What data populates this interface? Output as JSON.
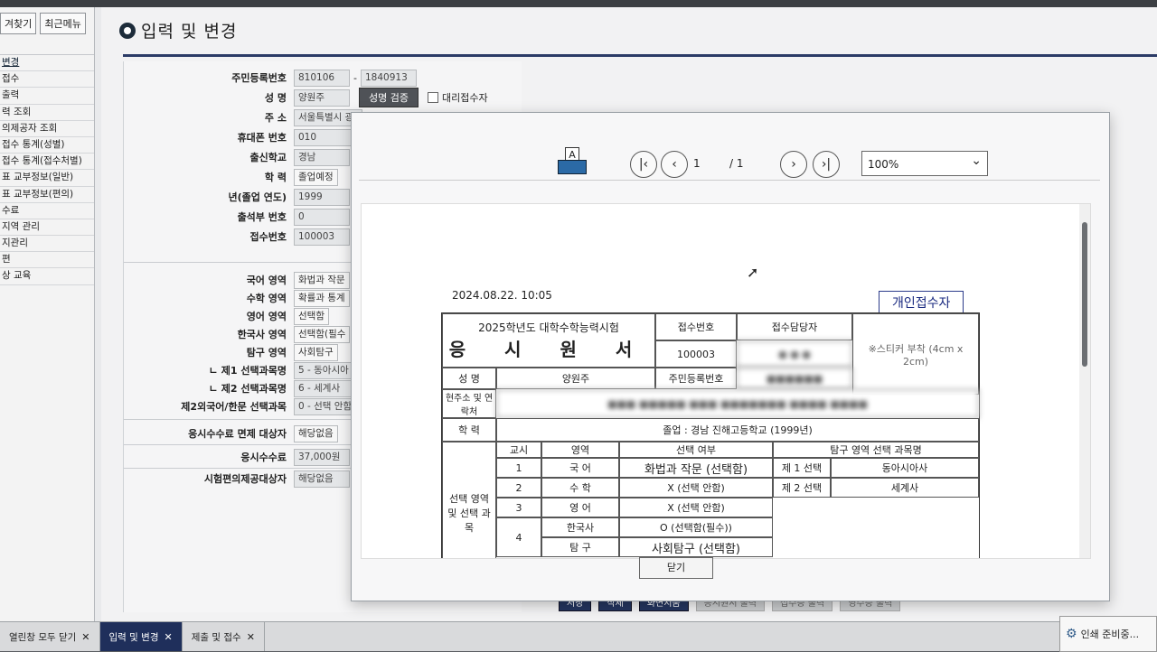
{
  "sidebar": {
    "tabs": [
      "겨찾기",
      "최근메뉴"
    ],
    "items": [
      "변경",
      "접수",
      "출력",
      "력 조회",
      "의제공자 조회",
      "접수 통계(성별)",
      "접수 통계(접수처별)",
      "표 교부정보(일반)",
      "표 교부정보(편의)",
      "수료",
      "지역 관리",
      "지관리",
      "편",
      "상 교육"
    ]
  },
  "main": {
    "page_title": "입력 및 변경",
    "form": {
      "jumin_label": "주민등록번호",
      "jumin_front": "810106",
      "jumin_sep": "-",
      "jumin_back": "1840913",
      "name_label": "성 명",
      "name_value": "양원주",
      "verify_label": "성명 검증",
      "proxy_label": "대리접수자",
      "addr_label": "주 소",
      "addr_value": "서울특별시 광",
      "phone_label": "휴대폰 번호",
      "phone_value": "010",
      "school_label": "출신학교",
      "school_value": "경남",
      "degree_label": "학 력",
      "degree_value": "졸업예정",
      "grad_label": "년(졸업 연도)",
      "grad_value": "1999",
      "attend_label": "출석부 번호",
      "attend_value": "0",
      "receipt_label": "접수번호",
      "receipt_value": "100003",
      "korean_label": "국어 영역",
      "korean_value": "화법과 작문",
      "math_label": "수학 영역",
      "math_value": "확률과 통계",
      "english_label": "영어 영역",
      "english_value": "선택함",
      "history_label": "한국사 영역",
      "history_value": "선택함(필수",
      "inquiry_label": "탐구 영역",
      "inquiry_value": "사회탐구",
      "sel1_label": "ㄴ 제1 선택과목명",
      "sel1_value": "5 - 동아시아",
      "sel2_label": "ㄴ 제2 선택과목명",
      "sel2_value": "6 - 세계사",
      "foreign_label": "제2외국어/한문 선택과목",
      "foreign_value": "0 - 선택 안함",
      "exempt_label": "응시수수료 면제 대상자",
      "exempt_value": "해당없음",
      "fee_label": "응시수수료",
      "fee_value": "37,000원",
      "conv_label": "시험편의제공대상자",
      "conv_value": "해당없음"
    },
    "bottom_buttons": [
      "저장",
      "삭제",
      "화면지움",
      "응시원서 출력",
      "접수증 출력",
      "영수증 출력"
    ]
  },
  "viewer": {
    "print_glyph": "A",
    "page_current": "1",
    "page_total": "/ 1",
    "zoom": "100%",
    "close_label": "닫기",
    "doc": {
      "date": "2024.08.22. 10:05",
      "badge": "개인접수자",
      "exam_name": "2025학년도 대학수학능력시험",
      "form_title": "응 시 원 서",
      "receipt_no_label": "접수번호",
      "receipt_no": "100003",
      "staff_label": "접수담당자",
      "sticker": "※스티커 부착 (4cm x 2cm)",
      "name_label": "성 명",
      "name": "양원주",
      "jumin_label": "주민등록번호",
      "addr_label": "현주소 및 연락처",
      "edu_label": "학 력",
      "edu": "졸업 : 경남 진해고등학교 (1999년)",
      "section_label": "선택 영역 및 선택 과목",
      "col_period": "교시",
      "col_area": "영역",
      "col_choice": "선택 여부",
      "col_inquiry": "탐구 영역 선택 과목명",
      "rows": [
        {
          "period": "1",
          "area": "국 어",
          "choice": "화법과 작문 (선택함)"
        },
        {
          "period": "2",
          "area": "수 학",
          "choice": "X (선택 안함)"
        },
        {
          "period": "3",
          "area": "영 어",
          "choice": "X (선택 안함)"
        },
        {
          "period": "4",
          "area": "한국사",
          "choice": "O (선택함(필수))"
        },
        {
          "period": "",
          "area": "탐 구",
          "choice": "사회탐구 (선택함)"
        }
      ],
      "sel1": "제 1 선택",
      "sel1_val": "동아시아사",
      "sel2": "제 2 선택",
      "sel2_val": "세계사"
    }
  },
  "taskbar": {
    "tabs": [
      "열린창 모두 닫기",
      "입력 및 변경",
      "제출 및 접수"
    ],
    "print_status": "인쇄 준비중..."
  }
}
